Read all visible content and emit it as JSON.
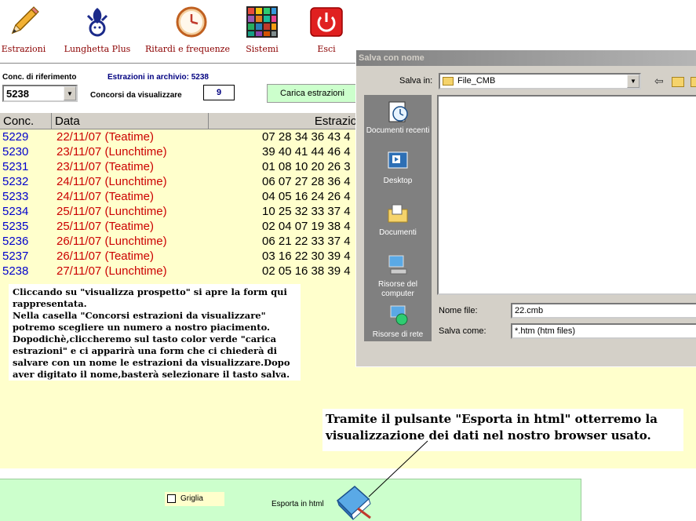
{
  "toolbar": {
    "items": [
      {
        "label": "Estrazioni",
        "icon": "pencil-icon"
      },
      {
        "label": "Lunghetta Plus",
        "icon": "lottery-logo-icon"
      },
      {
        "label": "Ritardi e frequenze",
        "icon": "clock-icon"
      },
      {
        "label": "Sistemi",
        "icon": "grid-icon"
      },
      {
        "label": "Esci",
        "icon": "power-icon"
      }
    ]
  },
  "controls": {
    "conc_label": "Conc. di riferimento",
    "archive_label": "Estrazioni in archivio: 5238",
    "conc_value": "5238",
    "concorsi_label": "Concorsi da visualizzare",
    "concorsi_value": "9",
    "load_button": "Carica estrazioni"
  },
  "table": {
    "headers": [
      "Conc.",
      "Data",
      "Estrazio"
    ],
    "rows": [
      {
        "conc": "5229",
        "date": "22/11/07  (Teatime)",
        "nums": "07 28 34 36 43 4"
      },
      {
        "conc": "5230",
        "date": "23/11/07  (Lunchtime)",
        "nums": "39 40 41 44 46 4"
      },
      {
        "conc": "5231",
        "date": "23/11/07  (Teatime)",
        "nums": "01 08 10 20 26 3"
      },
      {
        "conc": "5232",
        "date": "24/11/07  (Lunchtime)",
        "nums": "06 07 27 28 36 4"
      },
      {
        "conc": "5233",
        "date": "24/11/07  (Teatime)",
        "nums": "04 05 16 24 26 4"
      },
      {
        "conc": "5234",
        "date": "25/11/07  (Lunchtime)",
        "nums": "10 25 32 33 37 4"
      },
      {
        "conc": "5235",
        "date": "25/11/07  (Teatime)",
        "nums": "02 04 07 19 38 4"
      },
      {
        "conc": "5236",
        "date": "26/11/07  (Lunchtime)",
        "nums": "06 21 22 33 37 4"
      },
      {
        "conc": "5237",
        "date": "26/11/07  (Teatime)",
        "nums": "03 16 22 30 39 4"
      },
      {
        "conc": "5238",
        "date": "27/11/07  (Lunchtime)",
        "nums": "02 05 16 38 39 4"
      }
    ]
  },
  "notes": {
    "left": "Cliccando su \"visualizza prospetto\" si apre la form qui rappresentata.\nNella casella \"Concorsi estrazioni da visualizzare\" potremo scegliere un numero a nostro piacimento. Dopodichè,cliccheremo sul tasto color verde \"carica estrazioni\" e ci apparirà una form che ci chiederà di salvare con un nome le estrazioni da visualizzare.Dopo aver digitato il nome,basterà selezionare il tasto salva.",
    "right": "Tramite il pulsante \"Esporta in html\" otterremo la visualizzazione dei dati nel nostro browser usato."
  },
  "bottom": {
    "grid_label": "Griglia",
    "export_label": "Esporta in html"
  },
  "dialog": {
    "title": "Salva con nome",
    "save_in_label": "Salva in:",
    "save_in_value": "File_CMB",
    "places": [
      {
        "label": "Documenti recenti",
        "icon": "recent-documents-icon"
      },
      {
        "label": "Desktop",
        "icon": "desktop-icon"
      },
      {
        "label": "Documenti",
        "icon": "documents-folder-icon"
      },
      {
        "label": "Risorse del computer",
        "icon": "my-computer-icon"
      },
      {
        "label": "Risorse di rete",
        "icon": "network-icon"
      }
    ],
    "filename_label": "Nome file:",
    "filename_value": "22.cmb",
    "savetype_label": "Salva come:",
    "savetype_value": "*.htm (htm files)"
  }
}
